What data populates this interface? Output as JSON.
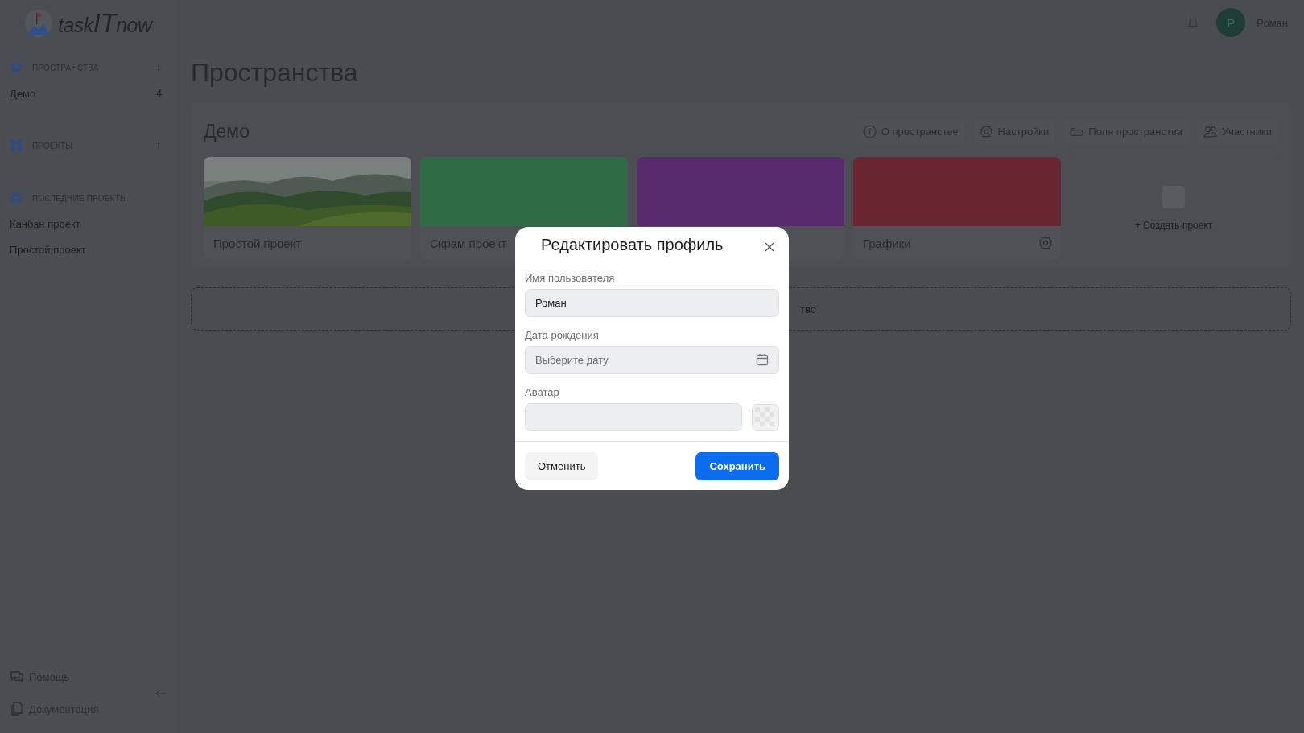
{
  "logo": {
    "parts": [
      "task",
      "IT",
      "now"
    ]
  },
  "sidebar": {
    "sections": [
      {
        "kind": "spaces",
        "title": "ПРОСТРАНСТВА",
        "addable": true,
        "items": [
          {
            "label": "Демо",
            "count": "4"
          }
        ]
      },
      {
        "kind": "projects",
        "title": "ПРОЕКТЫ",
        "addable": true
      },
      {
        "kind": "recent",
        "title": "ПОСЛЕДНИЕ ПРОЕКТЫ",
        "addable": false,
        "items": [
          {
            "label": "Канбан проект"
          },
          {
            "label": "Простой проект"
          }
        ]
      }
    ],
    "footer": [
      {
        "kind": "help",
        "label": "Помощь"
      },
      {
        "kind": "docs",
        "label": "Документация"
      }
    ]
  },
  "header": {
    "user": {
      "initial": "Р",
      "name": "Роман"
    }
  },
  "main": {
    "title": "Пространства",
    "space": {
      "name": "Демо",
      "actions": [
        {
          "kind": "info",
          "label": "О пространстве"
        },
        {
          "kind": "settings",
          "label": "Настройки"
        },
        {
          "kind": "fields",
          "label": "Поля пространства"
        },
        {
          "kind": "members",
          "label": "Участники"
        }
      ],
      "projects": [
        {
          "kind": "picture",
          "title": "Простой проект",
          "settings_icon": false
        },
        {
          "kind": "color",
          "color": "#2f6b45",
          "title": "Скрам проект"
        },
        {
          "kind": "color",
          "color": "#572a6b"
        },
        {
          "kind": "color",
          "color": "#6a2630",
          "title": "Графики",
          "settings_icon": true
        }
      ],
      "create_project": "+ Создать проект"
    },
    "create_space": "тво"
  },
  "modal": {
    "title": "Редактировать профиль",
    "fields": [
      {
        "kind": "text",
        "label": "Имя пользователя",
        "value": "Роман"
      },
      {
        "kind": "date",
        "label": "Дата рождения",
        "placeholder": "Выберите дату"
      },
      {
        "kind": "avatar",
        "label": "Аватар"
      }
    ],
    "cancel": "Отменить",
    "save": "Сохранить"
  }
}
